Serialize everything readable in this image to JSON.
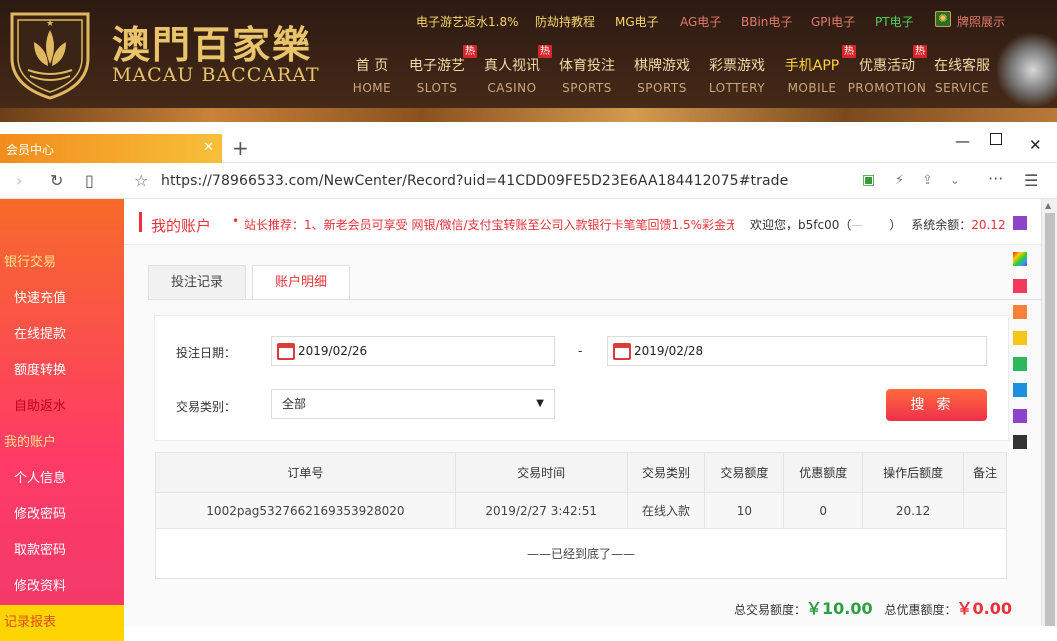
{
  "header": {
    "logo_cn": "澳門百家樂",
    "logo_en": "MACAU BACCARAT",
    "top_links": [
      {
        "label": "电子游艺返水1.8%",
        "color": "#f5d66b"
      },
      {
        "label": "防劫持教程",
        "color": "#f5d66b"
      },
      {
        "label": "MG电子",
        "color": "#f5d66b"
      },
      {
        "label": "AG电子",
        "color": "#e07a6a"
      },
      {
        "label": "BBin电子",
        "color": "#e07a6a"
      },
      {
        "label": "GPI电子",
        "color": "#e07a6a"
      },
      {
        "label": "PT电子",
        "color": "#4cd05a"
      },
      {
        "label": "牌照展示",
        "color": "#e07a6a"
      }
    ],
    "nav": [
      {
        "cn": "首 页",
        "en": "HOME",
        "hot": ""
      },
      {
        "cn": "电子游艺",
        "en": "SLOTS",
        "hot": "热"
      },
      {
        "cn": "真人视讯",
        "en": "CASINO",
        "hot": "热"
      },
      {
        "cn": "体育投注",
        "en": "SPORTS",
        "hot": ""
      },
      {
        "cn": "棋牌游戏",
        "en": "SPORTS",
        "hot": ""
      },
      {
        "cn": "彩票游戏",
        "en": "LOTTERY",
        "hot": ""
      },
      {
        "cn": "手机APP",
        "en": "MOBILE",
        "hot": "热"
      },
      {
        "cn": "优惠活动",
        "en": "PROMOTION",
        "hot": "热"
      },
      {
        "cn": "在线客服",
        "en": "SERVICE",
        "hot": ""
      }
    ]
  },
  "browser": {
    "tab_title": "会员中心",
    "url": "https://78966533.com/NewCenter/Record?uid=41CDD09FE5D23E6AA184412075#trade"
  },
  "sidebar": {
    "items": [
      {
        "label": "银行交易",
        "kind": "head"
      },
      {
        "label": "快速充值",
        "kind": "sub"
      },
      {
        "label": "在线提款",
        "kind": "sub"
      },
      {
        "label": "额度转换",
        "kind": "sub"
      },
      {
        "label": "自助返水",
        "kind": "sub active"
      },
      {
        "label": "我的账户",
        "kind": "head"
      },
      {
        "label": "个人信息",
        "kind": "sub"
      },
      {
        "label": "修改密码",
        "kind": "sub"
      },
      {
        "label": "取款密码",
        "kind": "sub"
      },
      {
        "label": "修改资料",
        "kind": "sub"
      },
      {
        "label": "记录报表",
        "kind": "bottom"
      }
    ]
  },
  "account": {
    "title": "我的账户",
    "marquee": "站长推荐：1、新老会员可享受 网银/微信/支付宝转账至公司入款银行卡笔笔回馈1.5%彩金无",
    "welcome": "欢迎您，b5fc00（",
    "welcome_close": "）",
    "balance_label": "系统余额：",
    "balance": "20.12"
  },
  "tabs": [
    "投注记录",
    "账户明细"
  ],
  "filter": {
    "date_label": "投注日期：",
    "date_from": "2019/02/26",
    "date_sep": "-",
    "date_to": "2019/02/28",
    "type_label": "交易类别：",
    "type_value": "全部",
    "search_label": "搜索"
  },
  "table": {
    "columns": [
      "订单号",
      "交易时间",
      "交易类别",
      "交易额度",
      "优惠额度",
      "操作后额度",
      "备注"
    ],
    "rows": [
      [
        "1002pag5327662169353928020",
        "2019/2/27 3:42:51",
        "在线入款",
        "10",
        "0",
        "20.12",
        ""
      ]
    ],
    "end_text": "——已经到底了——"
  },
  "totals": {
    "trade_label": "总交易额度：",
    "trade_value": "￥10.00",
    "promo_label": "总优惠额度：",
    "promo_value": "￥0.00"
  },
  "swatches": [
    "#8e44c8",
    "rainbow",
    "#f23a5a",
    "#f7803a",
    "#f5c518",
    "#2eb85c",
    "#1e90e0",
    "#8e44c8",
    "#333333"
  ]
}
